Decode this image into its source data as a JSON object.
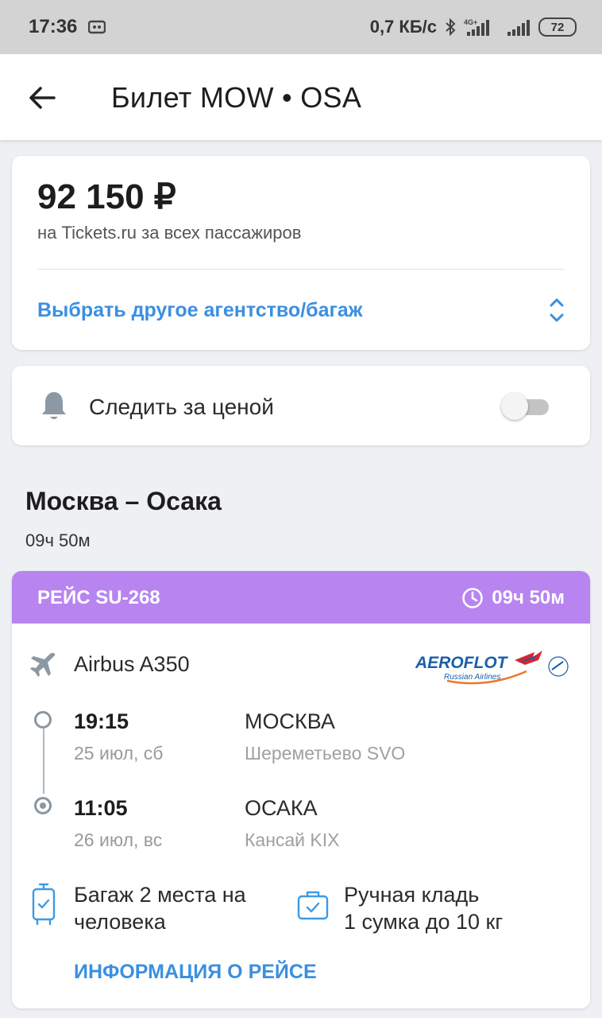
{
  "status_bar": {
    "time": "17:36",
    "net_speed": "0,7 КБ/с",
    "network": "4G+",
    "battery": "72"
  },
  "toolbar": {
    "title": "Билет MOW • OSA"
  },
  "price_card": {
    "price": "92 150 ₽",
    "subtitle": "на Tickets.ru за всех пассажиров",
    "agency_link": "Выбрать другое агентство/багаж"
  },
  "watch": {
    "label": "Следить за ценой",
    "enabled": false
  },
  "route": {
    "title": "Москва – Осака",
    "duration": "09ч 50м"
  },
  "flight": {
    "number": "РЕЙС SU-268",
    "duration": "09ч 50м",
    "aircraft": "Airbus A350",
    "airline_logo": {
      "name": "AEROFLOT",
      "sub": "Russian Airlines"
    },
    "departure": {
      "time": "19:15",
      "date": "25 июл, сб",
      "city": "МОСКВА",
      "airport": "Шереметьево SVO"
    },
    "arrival": {
      "time": "11:05",
      "date": "26 июл, вс",
      "city": "ОСАКА",
      "airport": "Кансай KIX"
    },
    "baggage": "Багаж 2 места на человека",
    "hand_luggage_line1": "Ручная кладь",
    "hand_luggage_line2": "1 сумка до 10 кг",
    "info_link": "ИНФОРМАЦИЯ О РЕЙСЕ"
  },
  "colors": {
    "accent": "#3b8fe0",
    "flight_header": "#b784f0",
    "background": "#eef0f4"
  }
}
